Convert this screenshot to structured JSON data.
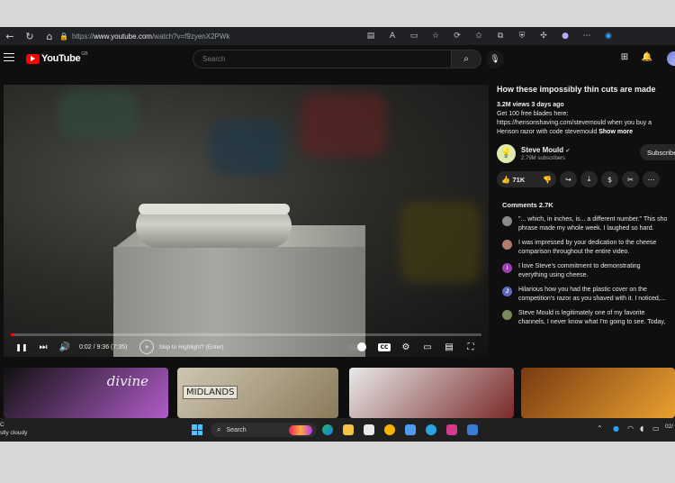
{
  "browser": {
    "url_prefix": "https://",
    "url_host": "www.youtube.com",
    "url_path": "/watch?v=f9zyenX2PWk",
    "nav_back": "←",
    "nav_reload": "↻",
    "nav_home": "⌂",
    "lock": "🔒"
  },
  "header": {
    "logo_text": "YouTube",
    "logo_region": "GB",
    "search_placeholder": "Search",
    "search_icon": "⌕",
    "mic_icon": "🎙",
    "create_icon": "⊞",
    "bell_icon": "🔔"
  },
  "player": {
    "progress_fraction": 0.005,
    "time": "0:02 / 9:36 (7:35)",
    "skip_text": "Skip to Highlight? (Enter)",
    "play_icon": "❚❚",
    "next_icon": "⏭",
    "volume_icon": "🔊",
    "cc_label": "CC",
    "settings_icon": "⚙",
    "theater_icon": "▭",
    "cast_icon": "▤",
    "fullscreen_icon": "⛶"
  },
  "video": {
    "title": "How these impossibly thin cuts are made",
    "stats": "3.2M views  3 days ago",
    "desc_line1": "Get 100 free blades here:",
    "desc_line2": "https://hensonshaving.com/stevemould when you buy a",
    "desc_line3": "Henson razor with code stevemould",
    "show_more": "Show more"
  },
  "channel": {
    "name": "Steve Mould",
    "verified": "✔",
    "subscribers": "2.79M subscribers",
    "subscribe_label": "Subscribe"
  },
  "actions": {
    "like_count": "71K",
    "like_icon": "👍",
    "dislike_icon": "👎",
    "share_icon": "↪",
    "download_icon": "⤓",
    "thanks_icon": "$",
    "clip_icon": "✂",
    "more_icon": "⋯"
  },
  "comments": {
    "header": "Comments  2.7K",
    "items": [
      {
        "line1": "\"... which, in inches, is... a different number.\" This sho",
        "line2": "phrase made my whole week. I laughed so hard.",
        "color": "#8a8a8a",
        "initial": ""
      },
      {
        "line1": "I was impressed by your dedication to the cheese",
        "line2": "comparison throughout the entire video.",
        "color": "#b07a6a",
        "initial": ""
      },
      {
        "line1": "I love Steve's commitment to demonstrating",
        "line2": "everything using cheese.",
        "color": "#9c3fb5",
        "initial": "I"
      },
      {
        "line1": "Hilarious how you had the plastic cover on the",
        "line2": "competition's razor as you shaved with it. I noticed,...",
        "color": "#5c6bc0",
        "initial": "J"
      },
      {
        "line1": "Steve Mould is legitimately one of my favorite",
        "line2": "channels, I never know what I'm going to see. Today,",
        "color": "#7a8a5a",
        "initial": ""
      }
    ]
  },
  "recommendations": [
    {
      "label": "divine",
      "colors": [
        "#111111",
        "#b05cc8"
      ]
    },
    {
      "label": "MIDLANDS",
      "colors": [
        "#cfc6b2",
        "#8a7a5a"
      ]
    },
    {
      "label": "",
      "colors": [
        "#e8e8e8",
        "#7a2a2a"
      ]
    },
    {
      "label": "",
      "colors": [
        "#7a3a10",
        "#e8a030"
      ]
    }
  ],
  "taskbar": {
    "weather_temp": "C",
    "weather_desc": "stly cloudy",
    "search_label": "Search",
    "search_icon": "⌕",
    "clock": "02/"
  }
}
